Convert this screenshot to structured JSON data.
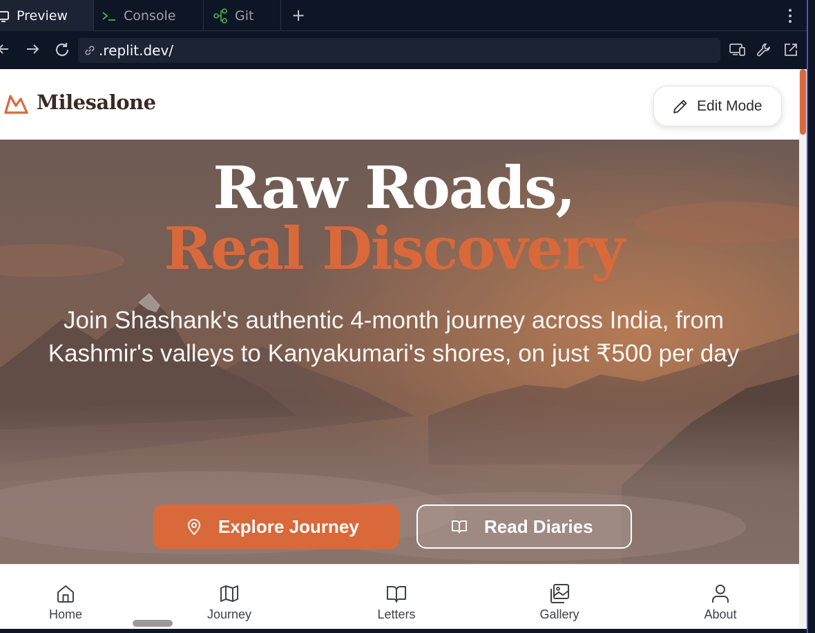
{
  "ide": {
    "tabs": [
      {
        "label": "Preview",
        "icon": "monitor-icon",
        "active": true
      },
      {
        "label": "Console",
        "icon": "terminal-icon",
        "active": false
      },
      {
        "label": "Git",
        "icon": "git-branch-icon",
        "active": false
      }
    ],
    "new_tab": "+",
    "url": ".replit.dev/"
  },
  "site": {
    "brand": "Milesalone",
    "edit_mode_label": "Edit Mode",
    "hero": {
      "title_line1": "Raw Roads,",
      "title_line2": "Real Discovery",
      "subtitle": "Join Shashank's authentic 4-month journey across India, from Kashmir's valleys to Kanyakumari's shores, on just ₹500 per day",
      "primary_button": "Explore Journey",
      "secondary_button": "Read Diaries"
    },
    "bottom_nav": [
      {
        "label": "Home",
        "icon": "home-icon"
      },
      {
        "label": "Journey",
        "icon": "map-icon"
      },
      {
        "label": "Letters",
        "icon": "book-open-icon"
      },
      {
        "label": "Gallery",
        "icon": "gallery-icon"
      },
      {
        "label": "About",
        "icon": "user-icon"
      }
    ]
  },
  "colors": {
    "accent": "#d9693a",
    "ide_bg": "#0e1525",
    "ide_panel": "#1c2333",
    "brand_text": "#3b2a22"
  }
}
